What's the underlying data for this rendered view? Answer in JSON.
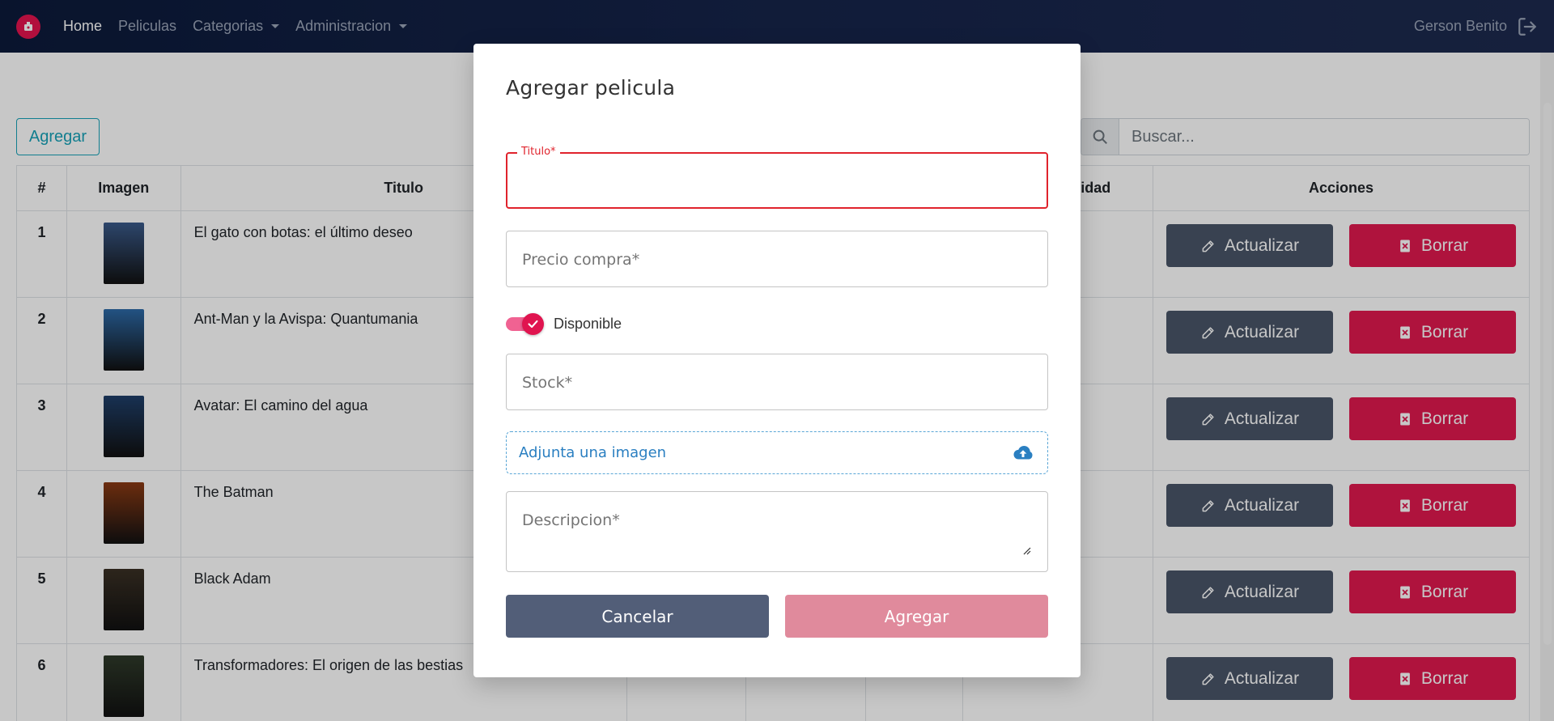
{
  "nav": {
    "home": "Home",
    "peliculas": "Peliculas",
    "categorias": "Categorias",
    "administracion": "Administracion",
    "user": "Gerson Benito"
  },
  "page": {
    "add_label": "Agregar",
    "search_placeholder": "Buscar..."
  },
  "table": {
    "headers": [
      "#",
      "Imagen",
      "Titulo",
      "idad",
      "Acciones"
    ],
    "update_label": "Actualizar",
    "delete_label": "Borrar",
    "rows": [
      {
        "num": "1",
        "title": "El gato con botas: el último deseo",
        "poster_color": "#3a5a8a"
      },
      {
        "num": "2",
        "title": "Ant-Man y la Avispa: Quantumania",
        "poster_color": "#2d6aa8"
      },
      {
        "num": "3",
        "title": "Avatar: El camino del agua",
        "poster_color": "#1f3f6a"
      },
      {
        "num": "4",
        "title": "The Batman",
        "poster_color": "#8a3a14"
      },
      {
        "num": "5",
        "title": "Black Adam",
        "poster_color": "#3a3024"
      },
      {
        "num": "6",
        "title": "Transformadores: El origen de las bestias",
        "poster_color": "#2f3a2a"
      }
    ]
  },
  "modal": {
    "title": "Agregar pelicula",
    "titulo_legend": "Titulo*",
    "titulo_value": "",
    "precio_placeholder": "Precio compra*",
    "disponible_label": "Disponible",
    "disponible_on": true,
    "stock_placeholder": "Stock*",
    "upload_label": "Adjunta una imagen",
    "descripcion_placeholder": "Descripcion*",
    "cancel_label": "Cancelar",
    "submit_label": "Agregar"
  },
  "colors": {
    "brand": "#e5144f",
    "navbar": "#16244a",
    "update_btn": "#4a5568",
    "delete_btn": "#e0194f",
    "cancel_btn": "#525e78",
    "submit_btn_disabled": "#e08a9c",
    "error_border": "#e0232c"
  }
}
